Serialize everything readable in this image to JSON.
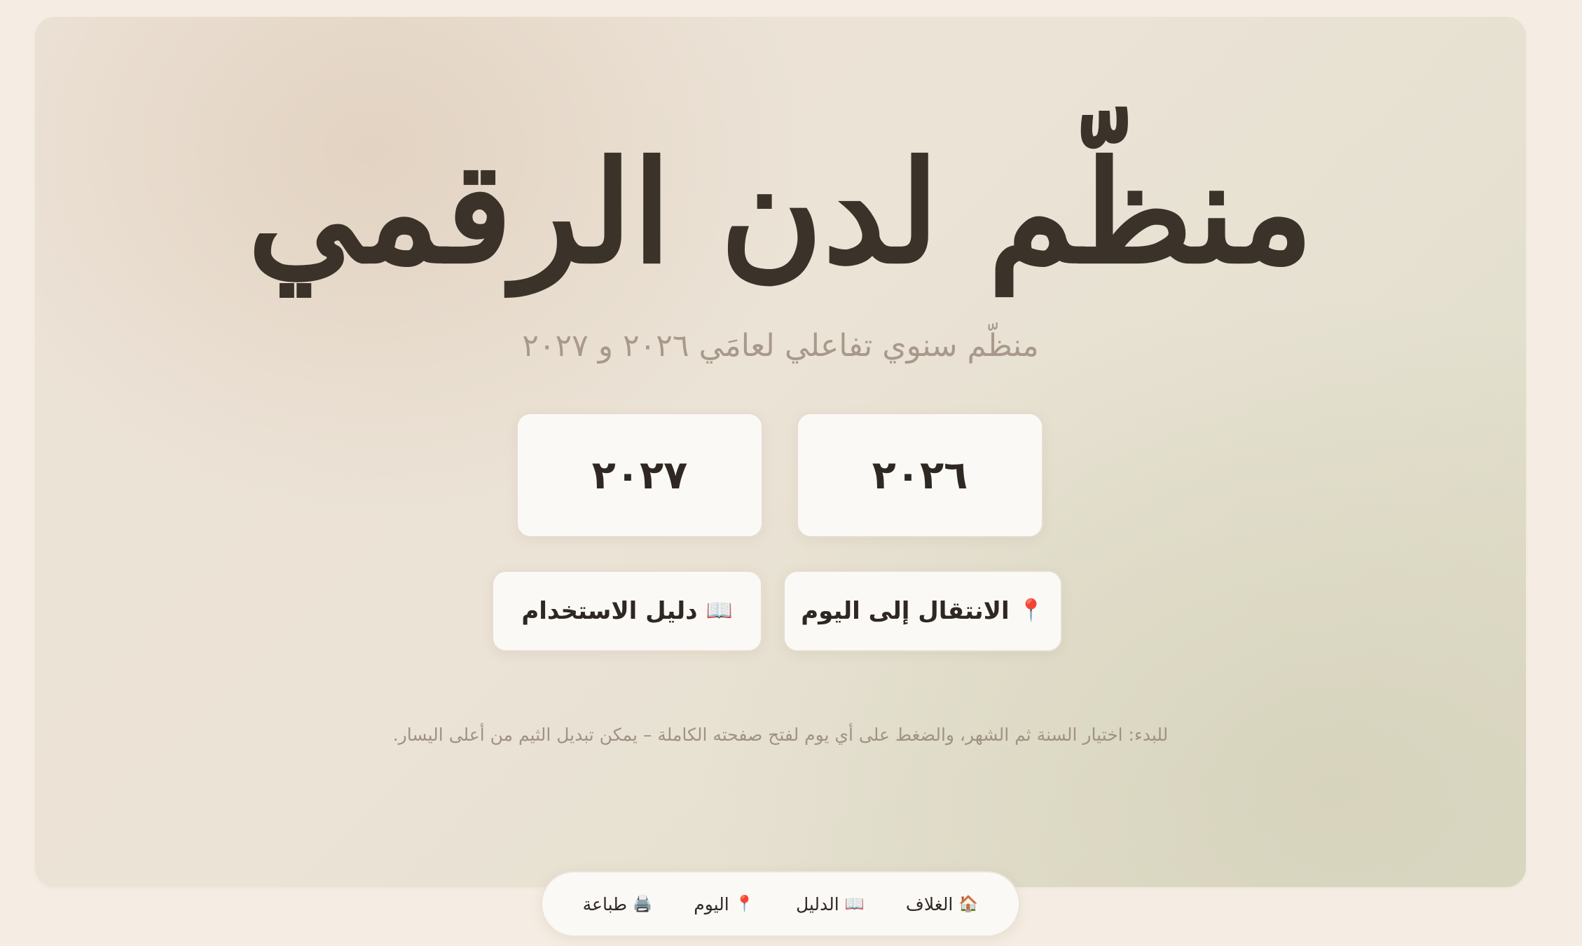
{
  "hero": {
    "title": "منظّم لدن الرقمي",
    "subtitle": "منظّم سنوي تفاعلي لعامَي ٢٠٢٦ و ٢٠٢٧",
    "hint": "للبدء: اختيار السنة ثم الشهر، والضغط على أي يوم لفتح صفحته الكاملة – يمكن تبديل الثيم من أعلى اليسار."
  },
  "years": [
    {
      "label": "٢٠٢٦"
    },
    {
      "label": "٢٠٢٧"
    }
  ],
  "actions": {
    "today": {
      "icon": "📍",
      "label": "الانتقال إلى اليوم"
    },
    "guide": {
      "icon": "📖",
      "label": "دليل الاستخدام"
    }
  },
  "bottom_nav": {
    "items": [
      {
        "icon": "🏠",
        "label": "الغلاف"
      },
      {
        "icon": "📖",
        "label": "الدليل"
      },
      {
        "icon": "📍",
        "label": "اليوم"
      },
      {
        "icon": "🖨️",
        "label": "طباعة"
      }
    ]
  },
  "colors": {
    "background": "#f5ede3",
    "card": "#fbf9f6",
    "text": "#3b3229",
    "muted": "#a8998a"
  }
}
